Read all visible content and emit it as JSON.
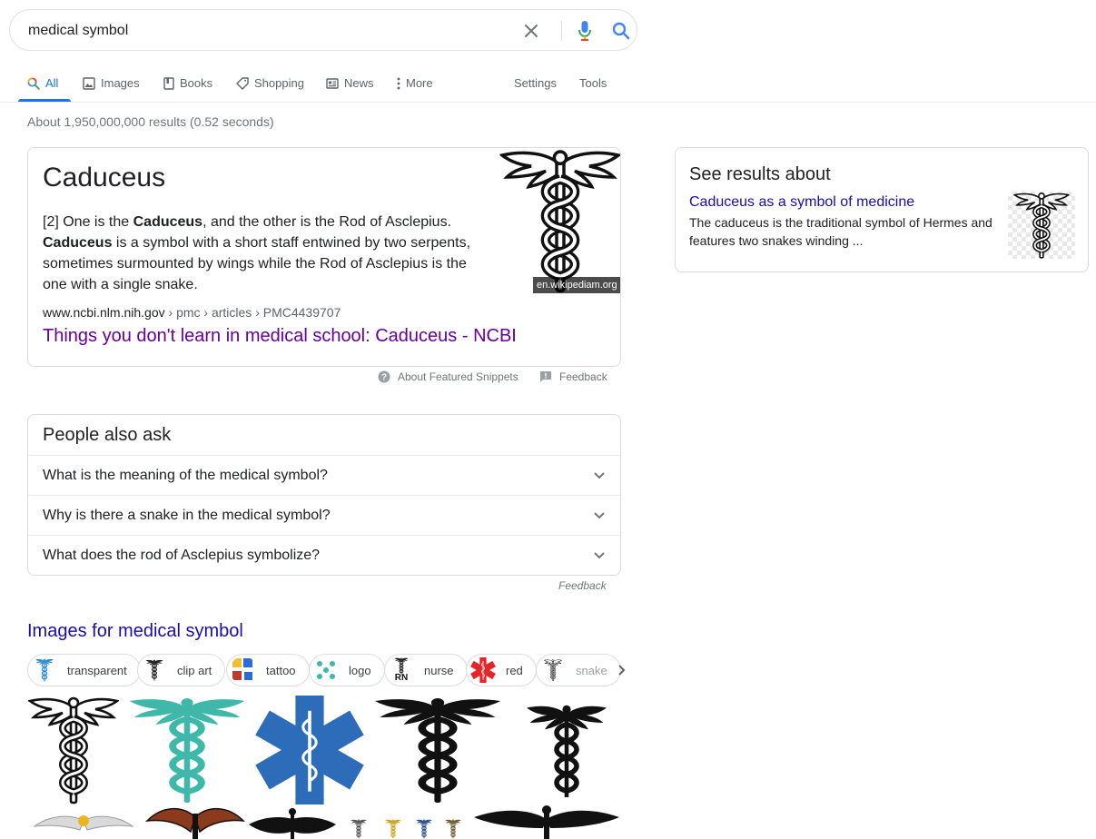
{
  "search": {
    "query": "medical symbol"
  },
  "tabs": {
    "all": "All",
    "images": "Images",
    "books": "Books",
    "shopping": "Shopping",
    "news": "News",
    "more": "More",
    "settings": "Settings",
    "tools": "Tools"
  },
  "stats": "About 1,950,000,000 results (0.52 seconds)",
  "featured": {
    "title": "Caduceus",
    "text_1": "[2] One is the ",
    "bold_1": "Caduceus",
    "text_2": ", and the other is the Rod of Asclepius. ",
    "bold_2": "Caduceus",
    "text_3": " is a symbol with a short staff entwined by two serpents, sometimes surmounted by wings while the Rod of Asclepius is the one with a single snake.",
    "cite_domain": "www.ncbi.nlm.nih.gov",
    "cite_path": " › pmc › articles › PMC4439707",
    "link": "Things you don't learn in medical school: Caduceus - NCBI",
    "image_source": "en.wikipediam.org"
  },
  "featured_footer": {
    "about": "About Featured Snippets",
    "feedback": "Feedback"
  },
  "paa": {
    "title": "People also ask",
    "questions": [
      "What is the meaning of the medical symbol?",
      "Why is there a snake in the medical symbol?",
      "What does the rod of Asclepius symbolize?"
    ],
    "feedback": "Feedback"
  },
  "images": {
    "title": "Images for medical symbol",
    "chips": [
      "transparent",
      "clip art",
      "tattoo",
      "logo",
      "nurse",
      "red",
      "snake"
    ],
    "rn_text": "RN"
  },
  "side": {
    "title": "See results about",
    "link": "Caduceus as a symbol of medicine",
    "desc": "The caduceus is the traditional symbol of Hermes and features two snakes winding ..."
  },
  "colors": {
    "link_blue": "#1a0dab",
    "visited": "#660099",
    "accent": "#1a73e8",
    "teal": "#3fb8a9",
    "star_of_life": "#2c6cb8",
    "red": "#e52629",
    "eagle_brown": "#8b3a1c"
  }
}
